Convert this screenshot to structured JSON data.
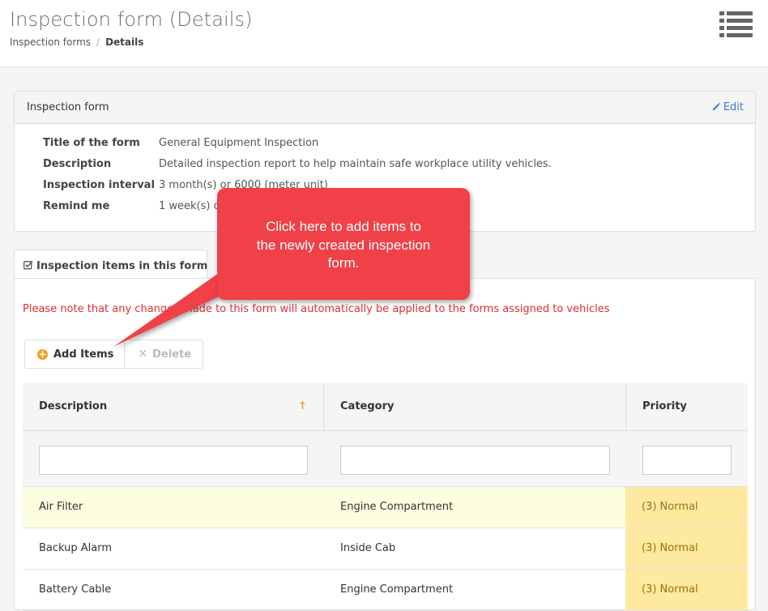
{
  "header": {
    "title": "Inspection form (Details)",
    "breadcrumb": {
      "parent": "Inspection forms",
      "separator": "/",
      "current": "Details"
    },
    "menu_icon": "list-icon"
  },
  "form_panel": {
    "title": "Inspection form",
    "edit_label": "Edit",
    "details": [
      {
        "label": "Title of the form",
        "value": "General Equipment Inspection"
      },
      {
        "label": "Description",
        "value": "Detailed inspection report to help maintain safe workplace utility vehicles."
      },
      {
        "label": "Inspection interval",
        "value": "3 month(s) or 6000 (meter unit)"
      },
      {
        "label": "Remind me",
        "value": "1 week(s) or"
      }
    ]
  },
  "items_tab": {
    "label": "Inspection items in this form",
    "notice": "Please note that any changes made to this form will automatically be applied to the forms assigned to vehicles",
    "add_label": "Add Items",
    "delete_label": "Delete",
    "columns": [
      "Description",
      "Category",
      "Priority"
    ],
    "rows": [
      {
        "description": "Air Filter",
        "category": "Engine Compartment",
        "priority": "(3) Normal"
      },
      {
        "description": "Backup Alarm",
        "category": "Inside Cab",
        "priority": "(3) Normal"
      },
      {
        "description": "Battery Cable",
        "category": "Engine Compartment",
        "priority": "(3) Normal"
      }
    ]
  },
  "callout": {
    "lines": [
      "Click here to add items to",
      "the newly created inspection",
      "form."
    ]
  },
  "colors": {
    "notice": "#e02d2d",
    "callout": "#f04048",
    "priority_bg": "#fde9a0",
    "selected_row": "#fdfde0",
    "link": "#3a7bc8"
  }
}
